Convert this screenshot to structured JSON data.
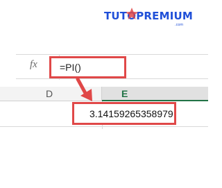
{
  "logo": {
    "text": "TUTOPREMIUM",
    "sub": ".com"
  },
  "formula_bar": {
    "fx_label": "fx",
    "formula": "=PI()"
  },
  "columns": [
    "D",
    "E"
  ],
  "cell": {
    "value": "3.14159265358979"
  },
  "colors": {
    "highlight": "#e04848",
    "excel_green": "#217346",
    "logo_blue": "#1f4fd8"
  }
}
